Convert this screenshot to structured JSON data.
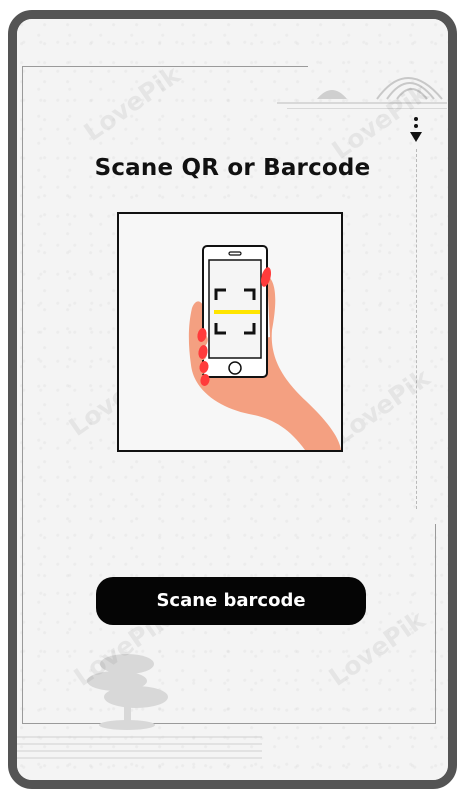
{
  "screen": {
    "title": "Scane QR or Barcode",
    "button_label": "Scane barcode"
  },
  "colors": {
    "frame": "#545454",
    "background": "#f4f4f4",
    "button": "#050505",
    "button_text": "#ffffff",
    "scan_line": "#ffe500",
    "hand": "#f4a081",
    "nails": "#ff3b3b"
  },
  "icons": {
    "scan_illustration": "phone-qr-scan-illustration-icon",
    "dropdown": "chevron-down-icon"
  }
}
